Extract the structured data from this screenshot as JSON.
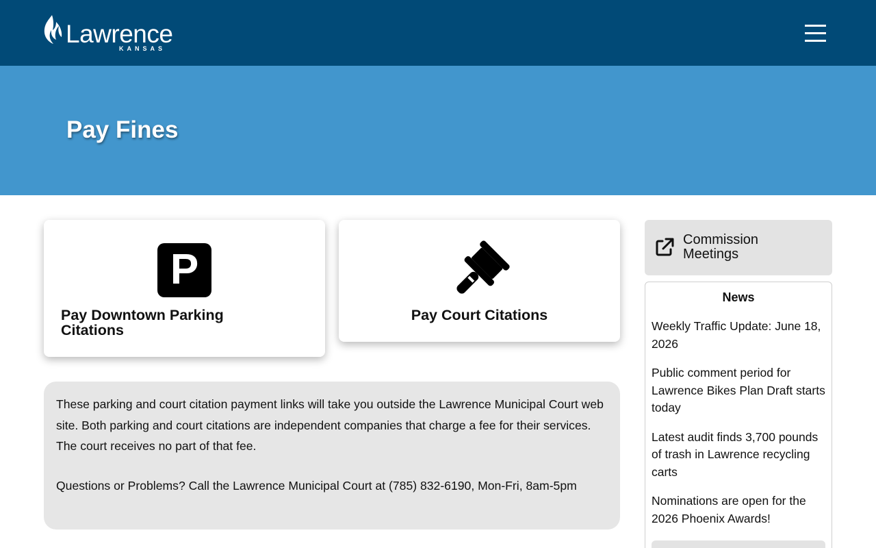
{
  "header": {
    "logo_text": "Lawrence",
    "logo_subtext": "KANSAS",
    "menu_icon": "hamburger-menu-icon"
  },
  "hero": {
    "title": "Pay Fines"
  },
  "cards": [
    {
      "label": "Pay Downtown Parking Citations",
      "icon": "parking-icon"
    },
    {
      "label": "Pay Court Citations",
      "icon": "gavel-icon"
    }
  ],
  "notice": {
    "paragraph_1": "These parking and court citation payment links will take you outside the Lawrence Municipal Court web site. Both parking and court citations are independent companies that charge a fee for their services. The court receives no part of that fee.",
    "paragraph_2": "Questions or Problems? Call the Lawrence Municipal Court at (785) 832-6190, Mon-Fri, 8am-5pm"
  },
  "sidebar": {
    "link_label": "Commission Meetings",
    "link_icon": "external-link-icon",
    "news": {
      "title": "News",
      "items": [
        "Weekly Traffic Update: June 18, 2026",
        "Public comment period for Lawrence Bikes Plan Draft starts today",
        "Latest audit finds 3,700 pounds of trash in Lawrence recycling carts",
        "Nominations are open for the 2026 Phoenix Awards!"
      ]
    }
  },
  "colors": {
    "header_bg": "#014a77",
    "hero_bg": "#4296cd",
    "notice_bg": "#e6e6e6",
    "sidebar_button_bg": "#e3e3e3"
  }
}
